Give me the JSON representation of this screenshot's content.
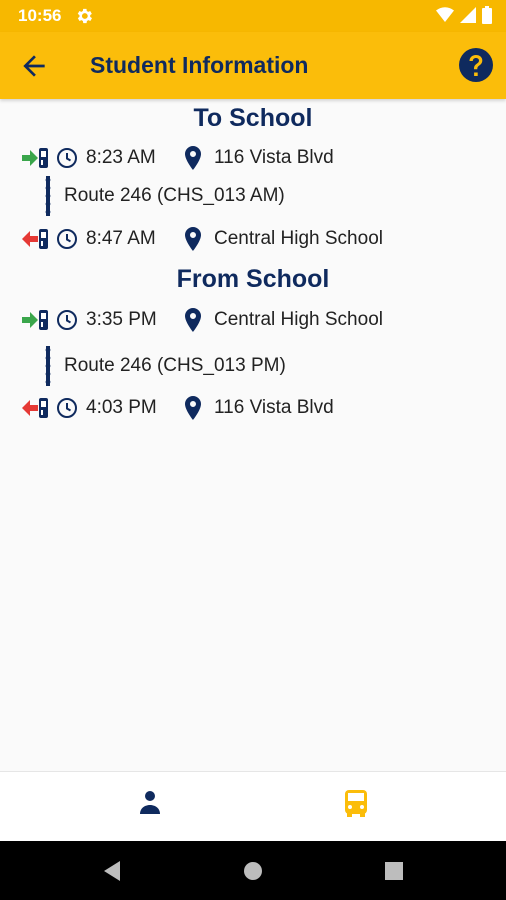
{
  "status_bar": {
    "time": "10:56"
  },
  "app_bar": {
    "title": "Student Information"
  },
  "to_school": {
    "heading": "To School",
    "pickup": {
      "time": "8:23 AM",
      "location": "116 Vista Blvd"
    },
    "route": "Route 246 (CHS_013 AM)",
    "dropoff": {
      "time": "8:47 AM",
      "location": "Central High School"
    }
  },
  "from_school": {
    "heading": "From School",
    "pickup": {
      "time": "3:35 PM",
      "location": "Central High School"
    },
    "route": "Route 246 (CHS_013 PM)",
    "dropoff": {
      "time": "4:03 PM",
      "location": "116 Vista Blvd"
    }
  },
  "colors": {
    "accent": "#fbbd0a",
    "navy": "#0f2a5e",
    "board_green": "#3aa64b",
    "exit_red": "#e53935"
  },
  "icons": {
    "board": "bus-board-icon",
    "exit": "bus-exit-icon",
    "clock": "clock-icon",
    "pin": "location-pin-icon",
    "route": "route-dots-icon",
    "student_tab": "person-icon",
    "bus_tab": "bus-icon"
  }
}
